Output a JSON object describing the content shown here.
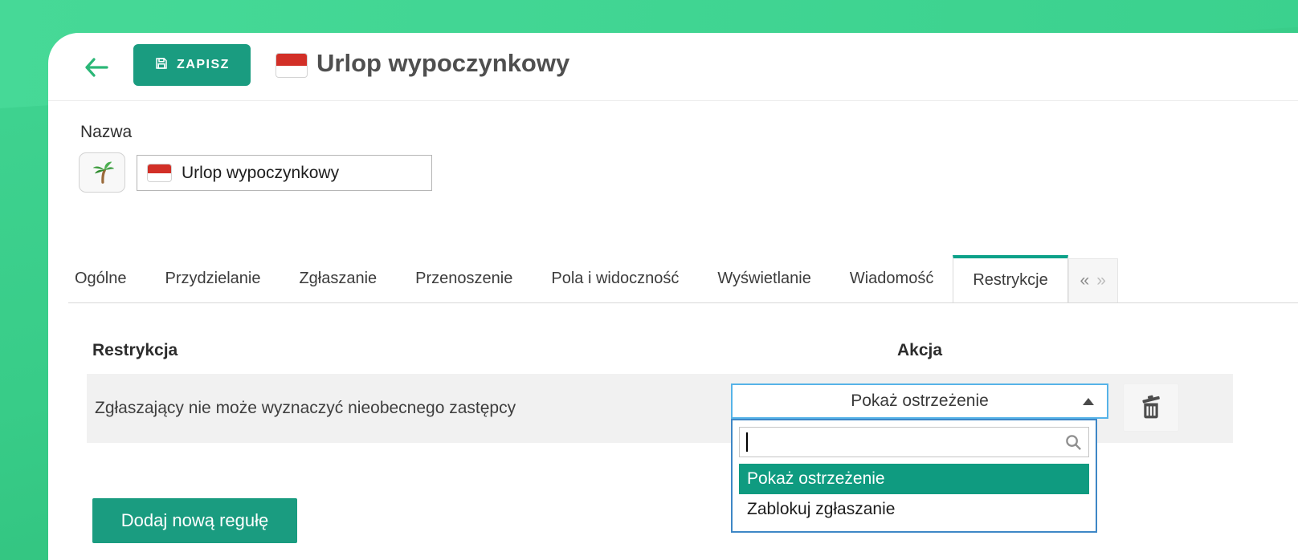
{
  "header": {
    "back_icon": "arrow-left-icon",
    "save_button_label": "ZAPISZ",
    "save_button_icon": "floppy-disk-icon",
    "title_flag_icon": "poland-flag-icon",
    "title": "Urlop wypoczynkowy"
  },
  "name_section": {
    "label": "Nazwa",
    "emoji_button_icon": "palm-tree-icon",
    "input_flag_icon": "poland-flag-icon",
    "input_value": "Urlop wypoczynkowy"
  },
  "tabs": {
    "items": [
      {
        "label": "Ogólne",
        "active": false
      },
      {
        "label": "Przydzielanie",
        "active": false
      },
      {
        "label": "Zgłaszanie",
        "active": false
      },
      {
        "label": "Przenoszenie",
        "active": false
      },
      {
        "label": "Pola i widoczność",
        "active": false
      },
      {
        "label": "Wyświetlanie",
        "active": false
      },
      {
        "label": "Wiadomość",
        "active": false
      },
      {
        "label": "Restrykcje",
        "active": true
      }
    ],
    "scroll_prev": "«",
    "scroll_next": "»"
  },
  "restrictions": {
    "column_restriction": "Restrykcja",
    "column_action": "Akcja",
    "rows": [
      {
        "restriction": "Zgłaszający nie może wyznaczyć nieobecnego zastępcy"
      }
    ],
    "action_dropdown": {
      "selected": "Pokaż ostrzeżenie",
      "search_value": "",
      "search_icon": "magnifier-icon",
      "options": [
        "Pokaż ostrzeżenie",
        "Zablokuj zgłaszanie"
      ],
      "highlighted_option": "Pokaż ostrzeżenie"
    },
    "delete_icon": "trash-icon",
    "add_rule_button": "Dodaj nową regułę"
  },
  "colors": {
    "background_green_top": "#41d492",
    "background_green_bottom": "#2ab875",
    "brand_teal_button": "#1a9c80",
    "option_highlight_teal": "#0f9b80",
    "active_tab_top_border": "#0ba189",
    "focused_select_border": "#56b3e8",
    "dropdown_panel_border": "#3e87c6",
    "row_background": "#f1f1f1",
    "flag_red": "#d22f27"
  }
}
